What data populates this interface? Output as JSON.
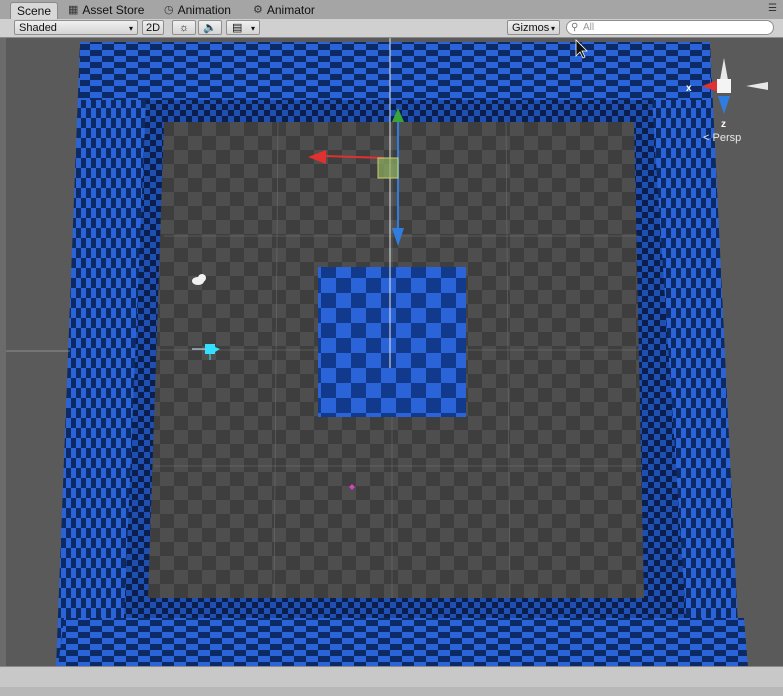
{
  "tabs": [
    {
      "label": "Scene",
      "icon": "scene-icon",
      "active": true
    },
    {
      "label": "Asset Store",
      "icon": "asset-store-icon",
      "active": false
    },
    {
      "label": "Animation",
      "icon": "animation-icon",
      "active": false
    },
    {
      "label": "Animator",
      "icon": "animator-icon",
      "active": false
    }
  ],
  "toolbar": {
    "draw_mode": "Shaded",
    "mode_2d": "2D",
    "lighting_icon": "sun-icon",
    "audio_icon": "speaker-icon",
    "effects_icon": "image-icon",
    "gizmos_label": "Gizmos",
    "search_placeholder": "All"
  },
  "scene_gizmo": {
    "x_label": "x",
    "z_label": "z",
    "projection_label": "Persp"
  },
  "colors": {
    "checker_blue": "#2a64d8",
    "checker_dark": "#0c2a66",
    "floor_light": "#4e4e4e",
    "floor_dark": "#3e3e3e",
    "axis_red": "#e03030",
    "axis_green": "#3aa33a",
    "axis_blue": "#2f7de0"
  }
}
